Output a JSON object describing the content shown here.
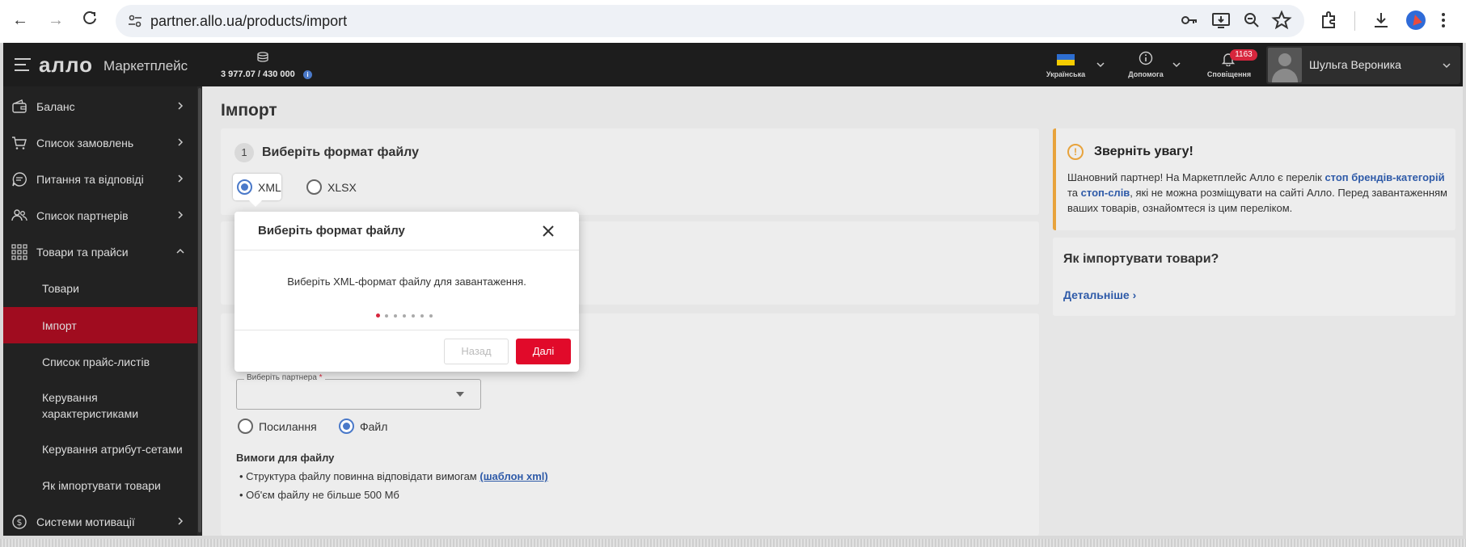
{
  "browser": {
    "url": "partner.allo.ua/products/import"
  },
  "app": {
    "logo": "алло",
    "logo_sub": "Маркетплейс",
    "balance": "3 977.07 / 430 000",
    "language_label": "Українська",
    "help_label": "Допомога",
    "notifications_label": "Сповіщення",
    "notifications_count": "1163",
    "user_name": "Шульга Вероника"
  },
  "sidebar": {
    "items": [
      {
        "label": "Баланс"
      },
      {
        "label": "Список замовлень"
      },
      {
        "label": "Питання та відповіді"
      },
      {
        "label": "Список партнерів"
      },
      {
        "label": "Товари та прайси"
      }
    ],
    "subitems": [
      {
        "label": "Товари"
      },
      {
        "label": "Імпорт"
      },
      {
        "label": "Список прайс-листів"
      },
      {
        "label": "Керування характеристиками"
      },
      {
        "label": "Керування атрибут-сетами"
      },
      {
        "label": "Як імпортувати товари"
      }
    ],
    "bottom_item": "Системи мотивації"
  },
  "main": {
    "title": "Імпорт",
    "step_number": "1",
    "step_title": "Виберіть формат файлу",
    "format_options": [
      "XML",
      "XLSX"
    ],
    "selected_format": "XML",
    "partner_select_label": "Виберіть партнера",
    "partner_select_required": "*",
    "source_options": [
      "Посилання",
      "Файл"
    ],
    "selected_source": "Файл",
    "requirements_title": "Вимоги для файлу",
    "requirement_1_text": "Структура файлу повинна відповідати вимогам",
    "requirement_1_link": "(шаблон xml)",
    "requirement_2_text": "Об'єм файлу не більше 500 Мб"
  },
  "attention": {
    "title": "Зверніть увагу!",
    "body_1": "Шановний партнер! На Маркетплейс Алло є перелік ",
    "link_1": "стоп брендів-категорій",
    "body_2": " та ",
    "link_2": "стоп-слів",
    "body_3": ", які не можна розміщувати на сайті Алло. Перед завантаженням ваших товарів, ознайомтеся із цим переліком."
  },
  "howto": {
    "title": "Як імпортувати товари?",
    "link": "Детальніше ›"
  },
  "modal": {
    "title": "Виберіть формат файлу",
    "text": "Виберіть XML-формат файлу для завантаження.",
    "steps_total": 7,
    "steps_current": 1,
    "back_label": "Назад",
    "next_label": "Далі"
  },
  "colors": {
    "accent": "#e10a2a",
    "link": "#2e5aa8",
    "radio": "#4a79c9",
    "warning": "#e8a33c"
  }
}
